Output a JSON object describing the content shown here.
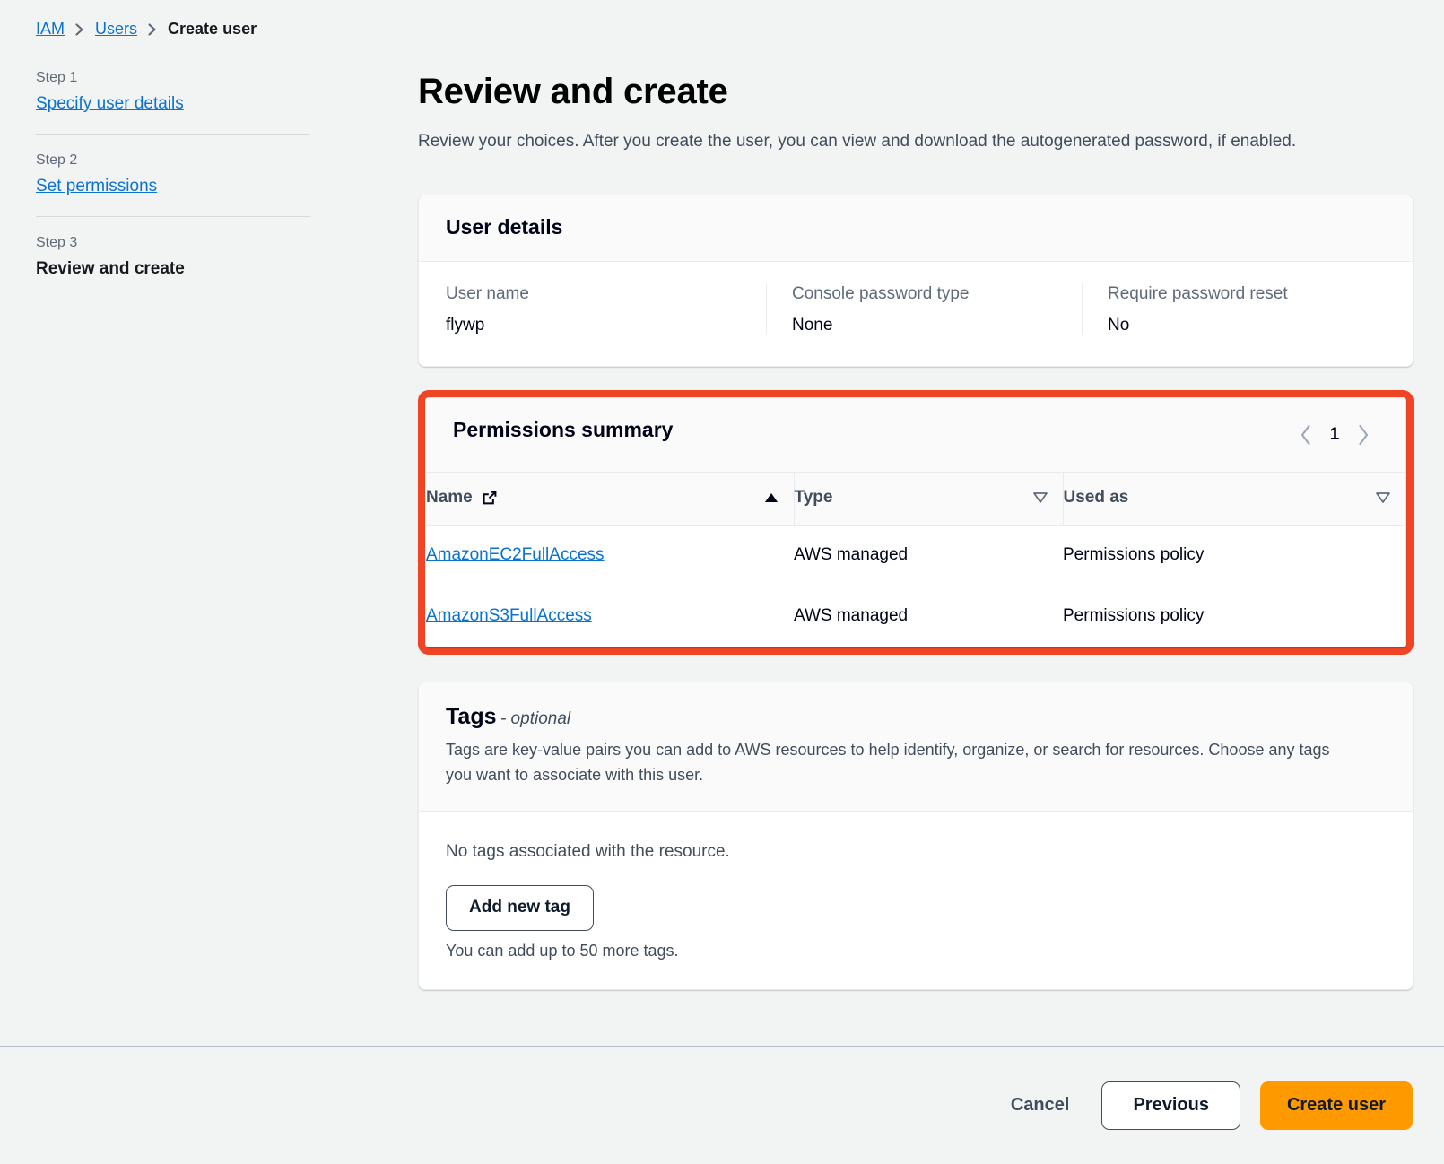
{
  "breadcrumb": {
    "items": [
      {
        "label": "IAM",
        "type": "link"
      },
      {
        "label": "Users",
        "type": "link"
      },
      {
        "label": "Create user",
        "type": "current"
      }
    ]
  },
  "sidebar": {
    "steps": [
      {
        "number": "Step 1",
        "label": "Specify user details",
        "state": "link"
      },
      {
        "number": "Step 2",
        "label": "Set permissions",
        "state": "link"
      },
      {
        "number": "Step 3",
        "label": "Review and create",
        "state": "current"
      }
    ]
  },
  "main": {
    "title": "Review and create",
    "description": "Review your choices. After you create the user, you can view and download the autogenerated password, if enabled."
  },
  "user_details": {
    "title": "User details",
    "fields": [
      {
        "label": "User name",
        "value": "flywp"
      },
      {
        "label": "Console password type",
        "value": "None"
      },
      {
        "label": "Require password reset",
        "value": "No"
      }
    ]
  },
  "permissions_summary": {
    "title": "Permissions summary",
    "highlight_color": "#f04424",
    "pagination": {
      "previous_icon": "chevron-left-icon",
      "page": "1",
      "next_icon": "chevron-right-icon"
    },
    "columns": [
      {
        "label": "Name",
        "icon": "external-link-icon",
        "sort": "ascending-active"
      },
      {
        "label": "Type",
        "icon": null,
        "sort": "descending-inactive"
      },
      {
        "label": "Used as",
        "icon": null,
        "sort": "descending-inactive"
      }
    ],
    "rows": [
      {
        "name": "AmazonEC2FullAccess",
        "type": "AWS managed",
        "used_as": "Permissions policy"
      },
      {
        "name": "AmazonS3FullAccess",
        "type": "AWS managed",
        "used_as": "Permissions policy"
      }
    ]
  },
  "tags": {
    "title": "Tags",
    "optional_suffix": "- optional",
    "description": "Tags are key-value pairs you can add to AWS resources to help identify, organize, or search for resources. Choose any tags you want to associate with this user.",
    "empty_message": "No tags associated with the resource.",
    "add_button": "Add new tag",
    "hint": "You can add up to 50 more tags."
  },
  "footer": {
    "cancel": "Cancel",
    "previous": "Previous",
    "create": "Create user",
    "primary_color": "#ff9900"
  }
}
